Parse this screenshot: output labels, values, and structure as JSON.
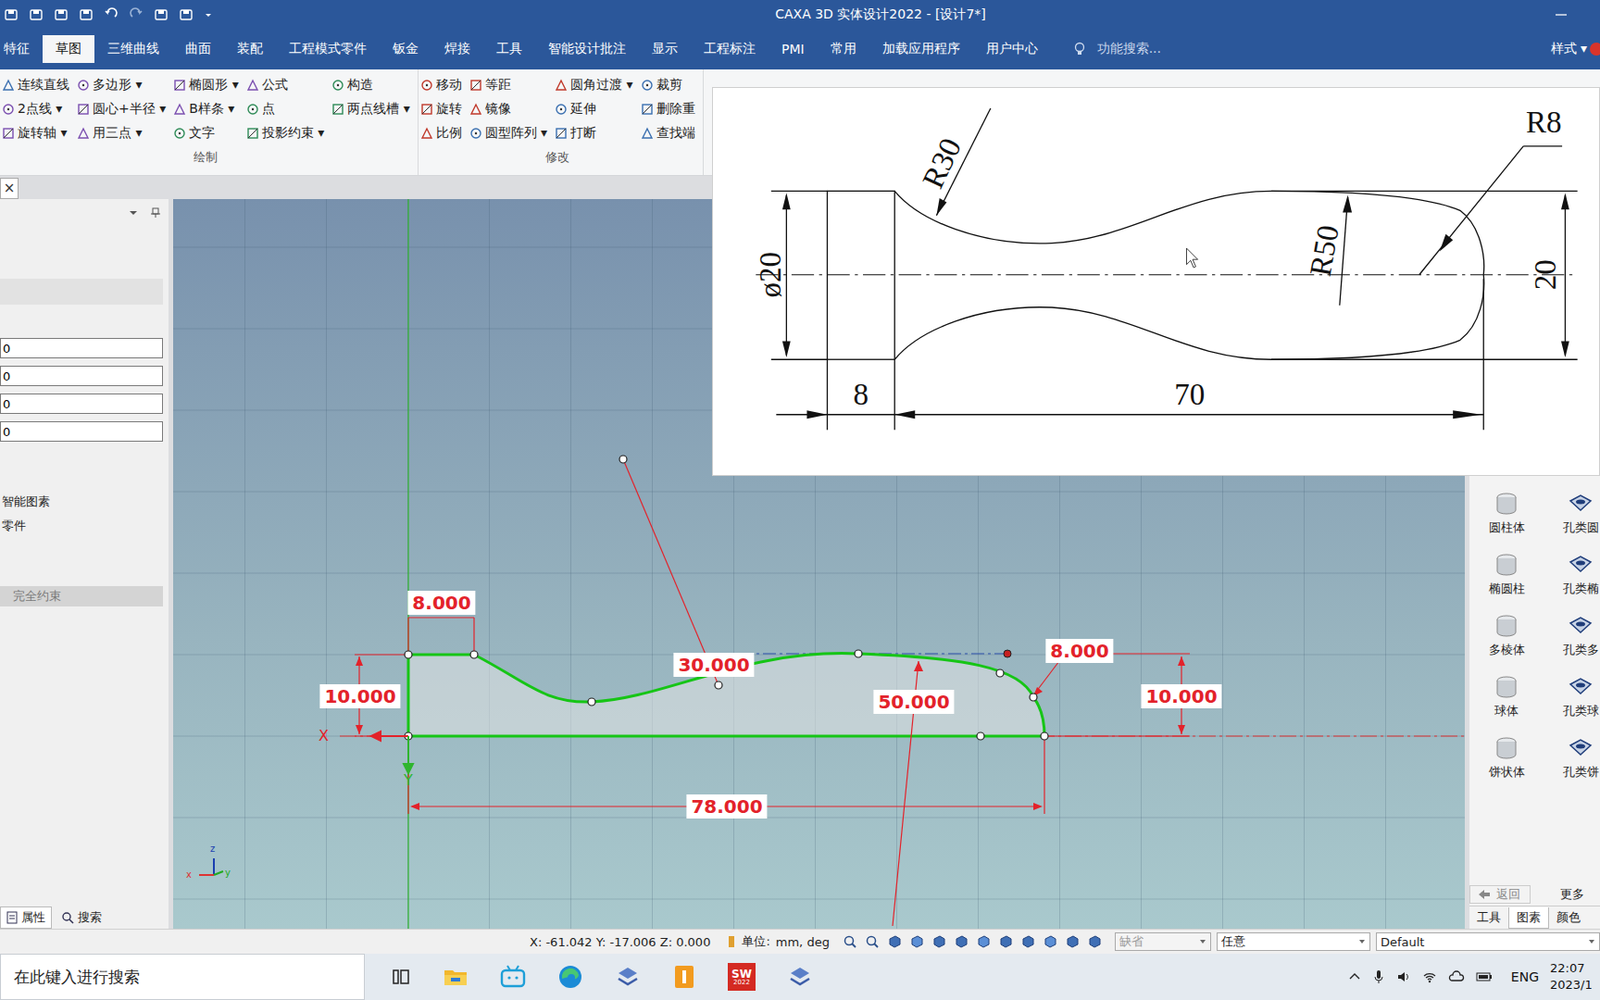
{
  "window": {
    "title": "CAXA 3D 实体设计2022 - [设计7*]"
  },
  "ribbon_tabs": [
    {
      "label": "特征",
      "selected": false
    },
    {
      "label": "草图",
      "selected": true
    },
    {
      "label": "三维曲线",
      "selected": false
    },
    {
      "label": "曲面",
      "selected": false
    },
    {
      "label": "装配",
      "selected": false
    },
    {
      "label": "工程模式零件",
      "selected": false
    },
    {
      "label": "钣金",
      "selected": false
    },
    {
      "label": "焊接",
      "selected": false
    },
    {
      "label": "工具",
      "selected": false
    },
    {
      "label": "智能设计批注",
      "selected": false
    },
    {
      "label": "显示",
      "selected": false
    },
    {
      "label": "工程标注",
      "selected": false
    },
    {
      "label": "PMI",
      "selected": false
    },
    {
      "label": "常用",
      "selected": false
    },
    {
      "label": "加载应用程序",
      "selected": false
    },
    {
      "label": "用户中心",
      "selected": false
    }
  ],
  "ribbon_search": {
    "placeholder": "功能搜索..."
  },
  "style_menu": "样式 ▾",
  "ribbon_groups": [
    {
      "label": "绘制",
      "columns": [
        [
          "连续直线",
          "2点线 ▾",
          "旋转轴 ▾"
        ],
        [
          "多边形 ▾",
          "圆心+半径 ▾",
          "用三点 ▾"
        ],
        [
          "椭圆形 ▾",
          "B样条 ▾",
          "文字"
        ],
        [
          "公式",
          "点",
          "投影约束 ▾"
        ],
        [
          "构造",
          "两点线槽 ▾"
        ]
      ]
    },
    {
      "label": "修改",
      "columns": [
        [
          "移动",
          "旋转",
          "比例"
        ],
        [
          "等距",
          "镜像",
          "圆型阵列 ▾"
        ],
        [
          "圆角过渡 ▾",
          "延伸",
          "打断"
        ],
        [
          "裁剪",
          "删除重",
          "查找端"
        ]
      ]
    }
  ],
  "doc_tab": {
    "close": "×"
  },
  "left_panel": {
    "fields": [
      "0",
      "0",
      "0",
      "0"
    ],
    "items": [
      "智能图素",
      "零件"
    ],
    "status_button": {
      "label": "完全约束",
      "disabled": true
    },
    "tabs": [
      {
        "label": "属性",
        "selected": true
      },
      {
        "label": "搜索",
        "selected": false
      }
    ]
  },
  "sketch": {
    "dimensions": [
      "8.000",
      "10.000",
      "30.000",
      "50.000",
      "8.000",
      "10.000",
      "78.000"
    ],
    "axis_x": "X",
    "axis_y": "Y",
    "triad": [
      "z",
      "x",
      "y"
    ]
  },
  "reference_drawing": {
    "labels": [
      "R30",
      "R8",
      "R50",
      "ø20",
      "20",
      "8",
      "70"
    ]
  },
  "right_panel": {
    "items": [
      "圆柱体",
      "孔类圆",
      "椭圆柱",
      "孔类椭",
      "多棱体",
      "孔类多",
      "球体",
      "孔类球",
      "饼状体",
      "孔类饼"
    ],
    "back": "返回",
    "more": "更多",
    "tabs": [
      {
        "label": "工具",
        "selected": false
      },
      {
        "label": "图素",
        "selected": true
      },
      {
        "label": "颜色",
        "selected": false
      }
    ]
  },
  "status_bar": {
    "coords": "X: -61.042 Y: -17.006 Z: 0.000",
    "unit_label": "单位:",
    "unit_value": "mm, deg",
    "dropdowns": [
      {
        "value": "缺省",
        "disabled": true
      },
      {
        "value": "任意",
        "disabled": false
      },
      {
        "value": "Default",
        "disabled": false
      }
    ]
  },
  "taskbar": {
    "search_placeholder": "在此键入进行搜索",
    "sw_badge": "SW",
    "sw_year": "2022",
    "lang": "ENG",
    "time": "22:07",
    "date": "2023/1"
  }
}
